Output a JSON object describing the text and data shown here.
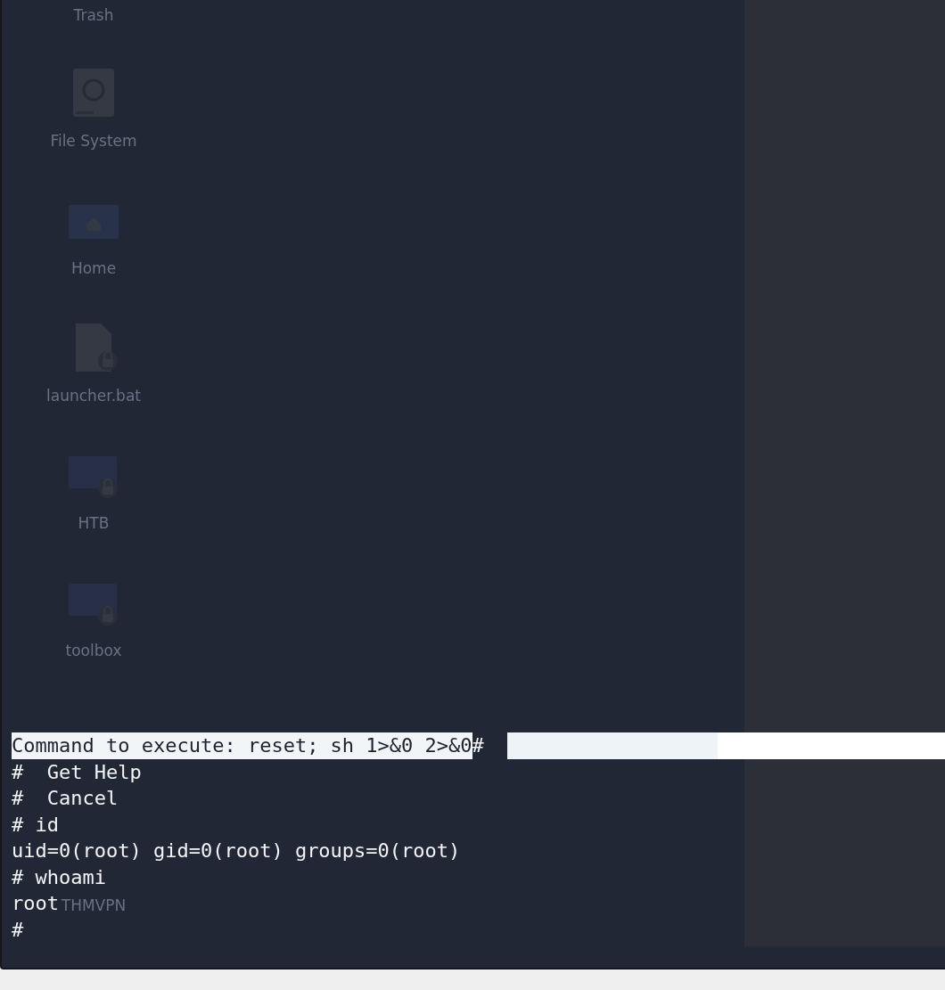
{
  "desktop": {
    "partial_label": "Trash",
    "icons": [
      {
        "label": "File System",
        "kind": "drive"
      },
      {
        "label": "Home",
        "kind": "home"
      },
      {
        "label": "launcher.bat",
        "kind": "locked-file"
      },
      {
        "label": "HTB",
        "kind": "locked-folder"
      },
      {
        "label": "toolbox",
        "kind": "locked-folder"
      }
    ],
    "bottom_label": "THMVPN"
  },
  "terminal": {
    "highlighted_command": "Command to execute: reset; sh 1>&0 2>&0",
    "prompt_after": "#",
    "lines": [
      "#  Get Help",
      "#  Cancel",
      "# id",
      "uid=0(root) gid=0(root) groups=0(root)",
      "# whoami",
      "root",
      "#"
    ]
  }
}
